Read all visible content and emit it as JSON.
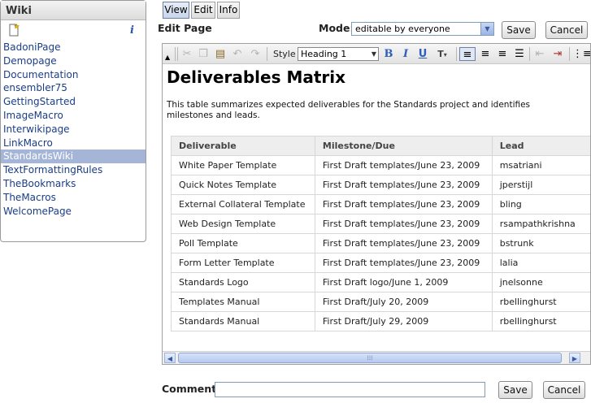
{
  "sidebar": {
    "title": "Wiki",
    "new_page_icon": "new-page-icon",
    "info_icon_glyph": "i",
    "pages": [
      {
        "label": "BadoniPage"
      },
      {
        "label": "Demopage"
      },
      {
        "label": "Documentation"
      },
      {
        "label": "ensembler75"
      },
      {
        "label": "GettingStarted"
      },
      {
        "label": "ImageMacro"
      },
      {
        "label": "Interwikipage"
      },
      {
        "label": "LinkMacro"
      },
      {
        "label": "StandardsWiki",
        "selected": true
      },
      {
        "label": "TextFormattingRules"
      },
      {
        "label": "TheBookmarks"
      },
      {
        "label": "TheMacros"
      },
      {
        "label": "WelcomePage"
      }
    ],
    "selected_color": "#a5b5d8",
    "link_color": "#1a3e86"
  },
  "tabs": [
    {
      "label": "View",
      "active": true
    },
    {
      "label": "Edit"
    },
    {
      "label": "Info"
    }
  ],
  "edit_page_title": "Edit Page",
  "mode": {
    "label": "Mode:",
    "selected": "editable by everyone"
  },
  "buttons": {
    "save": "Save",
    "cancel": "Cancel"
  },
  "toolbar": {
    "style_label": "Style",
    "style_selected": "Heading 1",
    "icons": [
      "cut-icon",
      "copy-icon",
      "paste-icon",
      "undo-icon",
      "redo-icon",
      "bold-icon",
      "italic-icon",
      "underline-icon",
      "text-color-icon",
      "align-left-icon",
      "align-center-icon",
      "align-right-icon",
      "justify-icon",
      "outdent-icon",
      "indent-icon",
      "list-icon"
    ]
  },
  "document": {
    "title": "Deliverables Matrix",
    "intro": "This table summarizes expected deliverables for the Standards project and identifies milestones and leads.",
    "table": {
      "headers": [
        "Deliverable",
        "Milestone/Due",
        "Lead"
      ],
      "rows": [
        [
          "White Paper Template",
          "First Draft templates/June 23, 2009",
          "msatriani"
        ],
        [
          "Quick Notes Template",
          "First Draft templates/June 23, 2009",
          "jperstijl"
        ],
        [
          "External Collateral Template",
          "First Draft templates/June 23, 2009",
          "bling"
        ],
        [
          "Web Design Template",
          "First Draft templates/June 23, 2009",
          "rsampathkrishna"
        ],
        [
          "Poll Template",
          "First Draft templates/June 23, 2009",
          "bstrunk"
        ],
        [
          "Form Letter Template",
          "First Draft templates/June 23, 2009",
          "lalia"
        ],
        [
          "Standards Logo",
          "First Draft logo/June 1, 2009",
          "jnelsonne"
        ],
        [
          "Templates Manual",
          "First Draft/July 20, 2009",
          "rbellinghurst"
        ],
        [
          "Standards Manual",
          "First Draft/July 29, 2009",
          "rbellinghurst"
        ]
      ]
    }
  },
  "comment": {
    "label": "Comment:",
    "value": ""
  }
}
